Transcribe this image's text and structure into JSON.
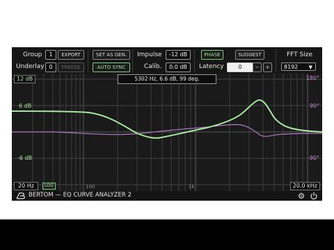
{
  "toolbar": {
    "group_label": "Group",
    "group_value": "1",
    "export_label": "EXPORT",
    "underlay_label": "Underlay",
    "underlay_value": "0",
    "freeze_label": "FREEZE",
    "set_as_gen_label": "SET AS GEN.",
    "auto_sync_label": "AUTO SYNC",
    "impulse_label": "Impulse",
    "impulse_value": "-12 dB",
    "calib_label": "Calib.",
    "calib_value": "0.0 dB",
    "phase_label": "PHASE",
    "suggest_label": "SUGGEST",
    "latency_label": "Latency",
    "latency_value": "0",
    "latency_minus": "−",
    "latency_plus": "+",
    "fft_size_label": "FFT Size",
    "fft_size_value": "8192",
    "fft_arrow": "▼"
  },
  "graph": {
    "readout": "5302 Hz, 6.6 dB, 99 deg.",
    "db_top_label": "12 dB",
    "db_mid_label": "6 dB",
    "db_low_label": "-6 dB",
    "phase_top_label": "180°",
    "phase_mid_label": "90°",
    "phase_low_label": "-90°",
    "freq_label_100": "100",
    "freq_label_1k": "1k",
    "min_freq": "20 Hz",
    "log_label": "LOG",
    "max_freq": "20.0 kHz",
    "colors": {
      "magnitude_curve": "#a8e8a0",
      "phase_curve": "#b07ac0",
      "db_labels": "#a8e8a0",
      "phase_labels": "#c090d0"
    }
  },
  "footer": {
    "logo_icon": "bertom-logo-icon",
    "title": "BERTOM — EQ CURVE ANALYZER 2",
    "settings_icon": "gear-icon",
    "power_icon": "power-icon"
  }
}
